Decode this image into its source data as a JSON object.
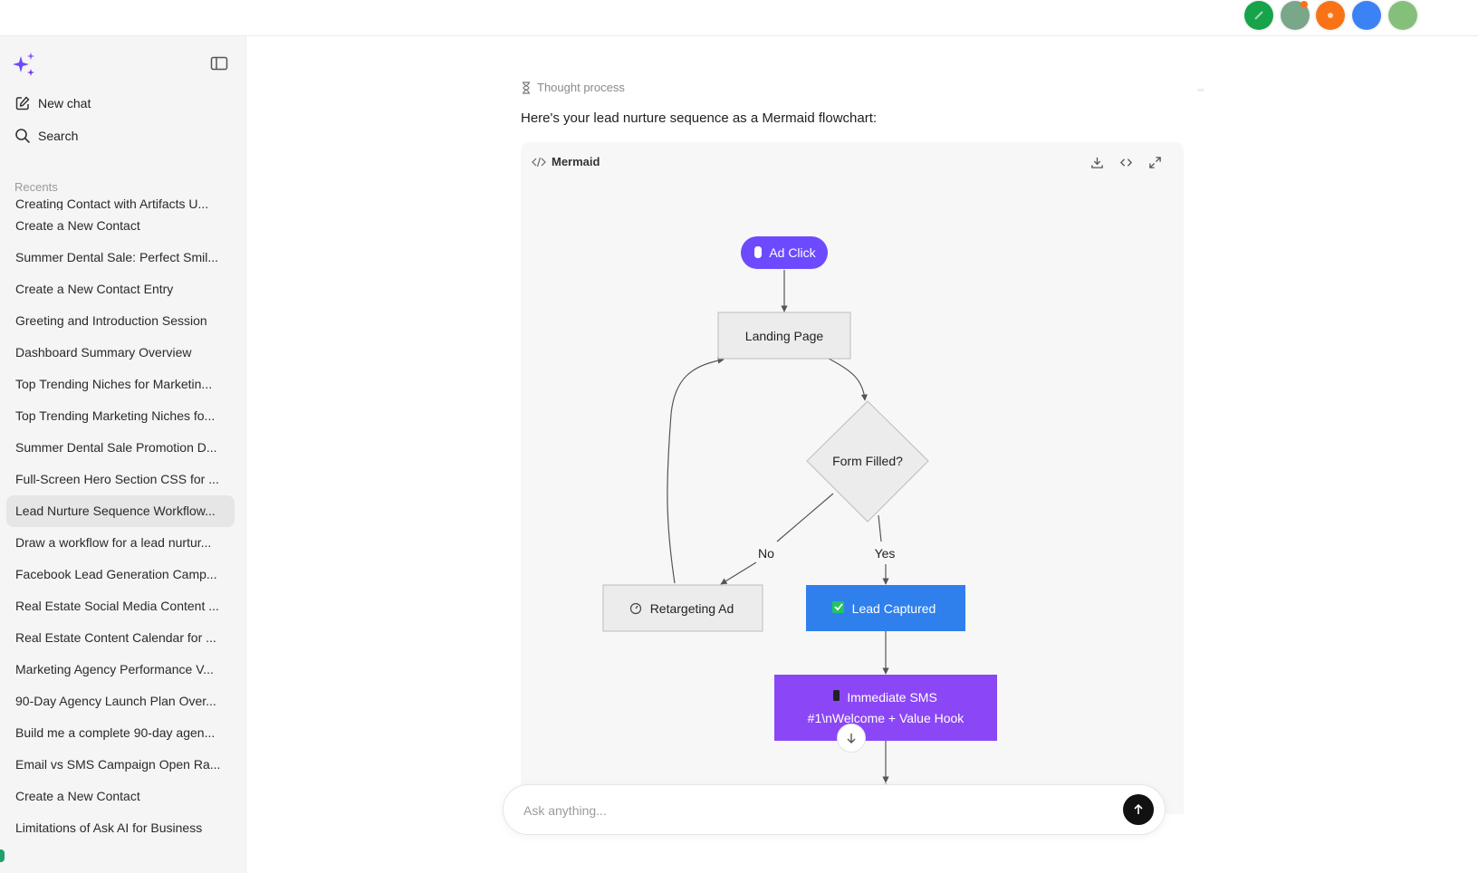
{
  "topbar": {
    "avatars": [
      {
        "name": "avatar-green",
        "color": "#16a34a"
      },
      {
        "name": "avatar-gray-green",
        "color": "#7aa68a"
      },
      {
        "name": "avatar-orange",
        "color": "#f97316"
      },
      {
        "name": "avatar-blue",
        "color": "#3b82f6"
      },
      {
        "name": "avatar-light-green",
        "color": "#84c07a"
      }
    ]
  },
  "sidebar": {
    "new_chat": "New chat",
    "search": "Search",
    "recents_label": "Recents",
    "recents": [
      "Creating Contact with Artifacts U...",
      "Create a New Contact",
      "Summer Dental Sale: Perfect Smil...",
      "Create a New Contact Entry",
      "Greeting and Introduction Session",
      "Dashboard Summary Overview",
      "Top Trending Niches for Marketin...",
      "Top Trending Marketing Niches fo...",
      "Summer Dental Sale Promotion D...",
      "Full-Screen Hero Section CSS for ...",
      "Lead Nurture Sequence Workflow...",
      "Draw a workflow for a lead nurtur...",
      "Facebook Lead Generation Camp...",
      "Real Estate Social Media Content ...",
      "Real Estate Content Calendar for ...",
      "Marketing Agency Performance V...",
      "90-Day Agency Launch Plan Over...",
      "Build me a complete 90-day agen...",
      "Email vs SMS Campaign Open Ra...",
      "Create a New Contact",
      "Limitations of Ask AI for Business"
    ],
    "active_index": 10
  },
  "chat": {
    "thought_label": "Thought process",
    "intro_text": "Here's your lead nurture sequence as a Mermaid flowchart:",
    "mermaid_label": "Mermaid",
    "flow": {
      "nodes": {
        "ad_click": "Ad Click",
        "landing_page": "Landing Page",
        "form_filled": "Form Filled?",
        "retargeting_ad": "Retargeting Ad",
        "lead_captured": "Lead Captured",
        "sms_line1": "Immediate SMS",
        "sms_line2": "#1\\nWelcome + Value Hook"
      },
      "edges": {
        "no": "No",
        "yes": "Yes"
      },
      "colors": {
        "ad_click_fill": "#6d4aff",
        "lead_captured_fill": "#2f80ed",
        "sms_fill": "#8b47f5",
        "neutral_fill": "#ececec",
        "neutral_stroke": "#bdbdbd",
        "edge": "#555555"
      }
    },
    "input_placeholder": "Ask anything..."
  }
}
